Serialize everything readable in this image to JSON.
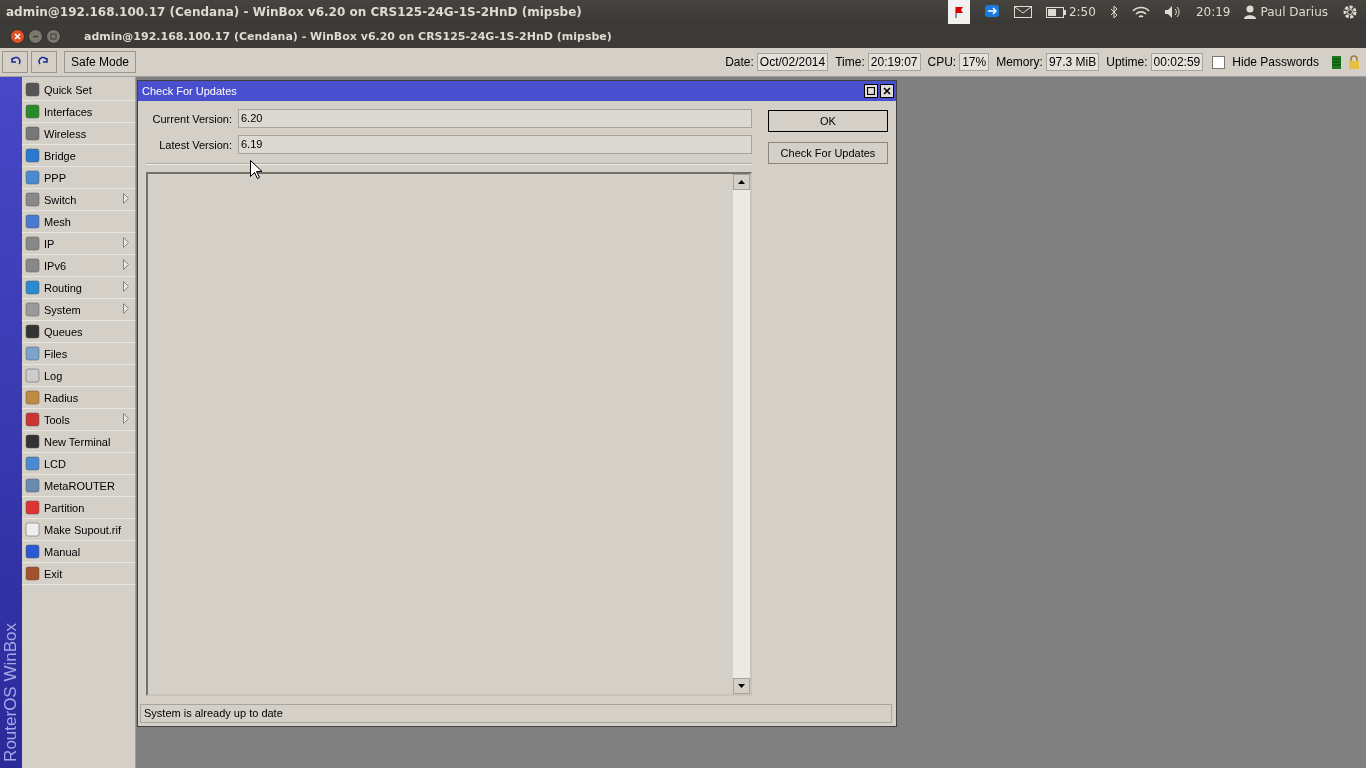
{
  "top_panel": {
    "title": "admin@192.168.100.17 (Cendana) - WinBox v6.20 on CRS125-24G-1S-2HnD (mipsbe)",
    "battery_time": "2:50",
    "clock": "20:19",
    "user": "Paul Darius"
  },
  "window": {
    "title": "admin@192.168.100.17 (Cendana) - WinBox v6.20 on CRS125-24G-1S-2HnD (mipsbe)"
  },
  "toolbar": {
    "safe_mode": "Safe Mode",
    "stats": [
      {
        "label": "Date:",
        "value": "Oct/02/2014"
      },
      {
        "label": "Time:",
        "value": "20:19:07"
      },
      {
        "label": "CPU:",
        "value": "17%"
      },
      {
        "label": "Memory:",
        "value": "97.3 MiB"
      },
      {
        "label": "Uptime:",
        "value": "00:02:59"
      }
    ],
    "hide_passwords": {
      "label": "Hide Passwords",
      "checked": false
    }
  },
  "sidebar": {
    "brand": "RouterOS WinBox",
    "items": [
      {
        "label": "Quick Set",
        "submenu": false
      },
      {
        "label": "Interfaces",
        "submenu": false
      },
      {
        "label": "Wireless",
        "submenu": false
      },
      {
        "label": "Bridge",
        "submenu": false
      },
      {
        "label": "PPP",
        "submenu": false
      },
      {
        "label": "Switch",
        "submenu": true
      },
      {
        "label": "Mesh",
        "submenu": false
      },
      {
        "label": "IP",
        "submenu": true
      },
      {
        "label": "IPv6",
        "submenu": true
      },
      {
        "label": "Routing",
        "submenu": true
      },
      {
        "label": "System",
        "submenu": true
      },
      {
        "label": "Queues",
        "submenu": false
      },
      {
        "label": "Files",
        "submenu": false
      },
      {
        "label": "Log",
        "submenu": false
      },
      {
        "label": "Radius",
        "submenu": false
      },
      {
        "label": "Tools",
        "submenu": true
      },
      {
        "label": "New Terminal",
        "submenu": false
      },
      {
        "label": "LCD",
        "submenu": false
      },
      {
        "label": "MetaROUTER",
        "submenu": false
      },
      {
        "label": "Partition",
        "submenu": false
      },
      {
        "label": "Make Supout.rif",
        "submenu": false
      },
      {
        "label": "Manual",
        "submenu": false
      },
      {
        "label": "Exit",
        "submenu": false
      }
    ]
  },
  "dialog": {
    "title": "Check For Updates",
    "fields": [
      {
        "label": "Current Version:",
        "value": "6.20"
      },
      {
        "label": "Latest Version:",
        "value": "6.19"
      }
    ],
    "buttons": [
      "OK",
      "Check For Updates"
    ],
    "status": "System is already up to date"
  }
}
